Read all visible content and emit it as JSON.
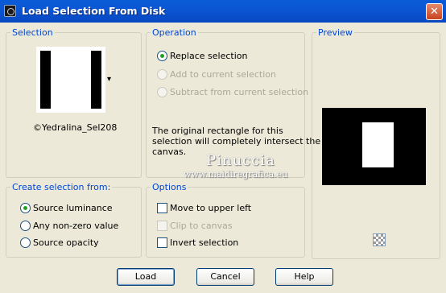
{
  "window": {
    "title": "Load Selection From Disk",
    "close_glyph": "✕"
  },
  "selection": {
    "label": "Selection",
    "file_name": "©Yedralina_Sel208",
    "dropdown_glyph": "▾"
  },
  "operation": {
    "label": "Operation",
    "options": [
      {
        "label": "Replace selection",
        "selected": true,
        "enabled": true
      },
      {
        "label": "Add to current selection",
        "selected": false,
        "enabled": false
      },
      {
        "label": "Subtract from current selection",
        "selected": false,
        "enabled": false
      }
    ],
    "description": [
      "The original rectangle for this",
      "selection will completely intersect the",
      "canvas."
    ]
  },
  "preview": {
    "label": "Preview"
  },
  "create_from": {
    "label": "Create selection from:",
    "options": [
      {
        "label": "Source luminance",
        "selected": true
      },
      {
        "label": "Any non-zero value",
        "selected": false
      },
      {
        "label": "Source opacity",
        "selected": false
      }
    ]
  },
  "options": {
    "label": "Options",
    "move_upper_left": {
      "label": "Move to upper left",
      "checked": false,
      "enabled": true
    },
    "clip_to_canvas": {
      "label": "Clip to canvas",
      "checked": false,
      "enabled": false
    },
    "invert_selection": {
      "label": "Invert selection",
      "checked": false,
      "enabled": true
    }
  },
  "buttons": {
    "load": "Load",
    "cancel": "Cancel",
    "help": "Help"
  },
  "watermark": {
    "name": "Pinuccia",
    "url": "www.maidiregrafica.eu"
  }
}
